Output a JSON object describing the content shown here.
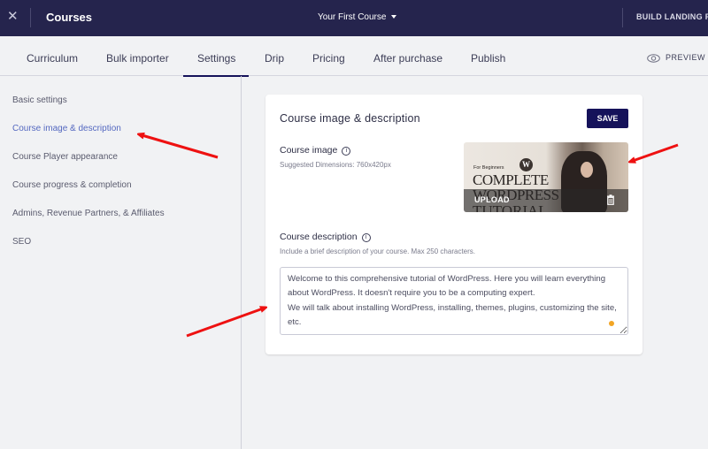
{
  "topbar": {
    "close_icon": "close-icon",
    "title": "Courses",
    "course_selector": "Your First Course",
    "build_landing_page": "BUILD LANDING PA"
  },
  "tabs": [
    {
      "label": "Curriculum",
      "active": false
    },
    {
      "label": "Bulk importer",
      "active": false
    },
    {
      "label": "Settings",
      "active": true
    },
    {
      "label": "Drip",
      "active": false
    },
    {
      "label": "Pricing",
      "active": false
    },
    {
      "label": "After purchase",
      "active": false
    },
    {
      "label": "Publish",
      "active": false
    }
  ],
  "preview": {
    "label": "PREVIEW",
    "icon": "eye-icon"
  },
  "sidebar": {
    "items": [
      {
        "label": "Basic settings",
        "active": false
      },
      {
        "label": "Course image & description",
        "active": true
      },
      {
        "label": "Course Player appearance",
        "active": false
      },
      {
        "label": "Course progress & completion",
        "active": false
      },
      {
        "label": "Admins, Revenue Partners, & Affiliates",
        "active": false
      },
      {
        "label": "SEO",
        "active": false
      }
    ]
  },
  "card": {
    "title": "Course image & description",
    "save_label": "SAVE",
    "course_image": {
      "label": "Course image",
      "hint": "Suggested Dimensions: 760x420px",
      "thumbnail": {
        "subtitle": "For Beginners",
        "logo": "W",
        "line1": "COMPLETE",
        "line2": "WORDPRESS",
        "line3": "TUTORIAL"
      },
      "upload_label": "UPLOAD",
      "delete_icon": "trash-icon"
    },
    "course_description": {
      "label": "Course description",
      "hint": "Include a brief description of your course. Max 250 characters.",
      "value": "Welcome to this comprehensive tutorial of WordPress. Here you will learn everything about WordPress. It doesn't require you to be a computing expert.\nWe will talk about installing WordPress, installing, themes, plugins, customizing the site,  etc."
    }
  },
  "colors": {
    "topbar_bg": "#25244d",
    "accent": "#15125a",
    "sidebar_active": "#5468c0",
    "annotation_arrow": "#ee1111",
    "grammarly_dot": "#f2a524"
  }
}
